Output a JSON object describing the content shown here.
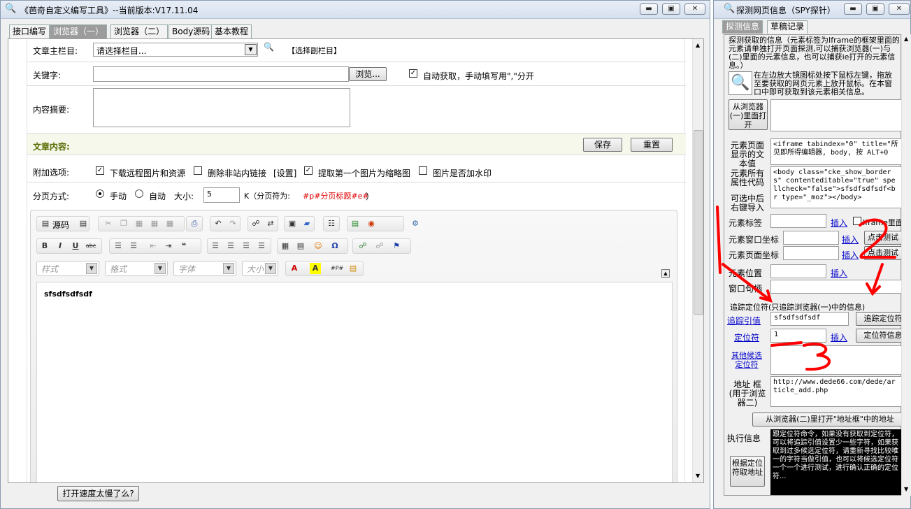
{
  "main_window": {
    "title": "《芭奇自定义编写工具》--当前版本:V17.11.04",
    "tabs": [
      "接口编写",
      "浏览器（一）",
      "浏览器（二）",
      "Body源码",
      "基本教程"
    ],
    "form": {
      "column_label": "文章主栏目:",
      "column_value": "请选择栏目...",
      "sub_column_link": "【选择副栏目】",
      "keywords_label": "关键字:",
      "keywords_value": "",
      "browse_button": "浏览...",
      "auto_fetch_label": "自动获取，手动填写用\",\"分开",
      "summary_label": "内容摘要:",
      "content_label": "文章内容:",
      "save_button": "保存",
      "reset_button": "重置",
      "extra_label": "附加选项:",
      "opt_download": "下载远程图片和资源",
      "opt_remove_links": "删除非站内链接",
      "opt_settings": "[设置]",
      "opt_first_image": "提取第一个图片为缩略图",
      "opt_watermark": "图片是否加水印",
      "paging_label": "分页方式:",
      "paging_manual": "手动",
      "paging_auto": "自动",
      "size_label": "大小:",
      "size_value": "5",
      "size_unit": "K（分页符为:",
      "paging_token": "#p#分页标题#e#",
      "paging_close": "）"
    },
    "editor": {
      "source_label": "源码",
      "style_combo": "样式",
      "format_combo": "格式",
      "font_combo": "字体",
      "size_combo": "大小",
      "content": "sfsdfsdfsdf"
    },
    "speed_button": "打开速度太慢了么?"
  },
  "spy_window": {
    "title": "探测网页信息（SPY探针）",
    "tabs": [
      "探测信息",
      "草稿记录"
    ],
    "intro_text": "探测获取的信息（元素标签为Iframe的框架里面的元素请单独打开页面探测,可以捕获浏览器(一)与(二)里面的元素信息，也可以捕获ie打开的元素信息。）",
    "magnifier_text": "在左边放大镜图标处按下鼠标左键，拖放至要获取的网页元素上放开鼠标。在本窗口中即可获取到该元素相关信息。",
    "open_from_browser1": "从浏览器(一)里面打开",
    "element_text_label": "元素页面显示的文本值",
    "element_text_value": "<iframe tabindex=\"0\" title=\"所见即所得编辑器, body, 按 ALT+0",
    "element_attrs_label": "元素所有属性代码",
    "element_attrs_value": "<body class=\"cke_show_borders\" contenteditable=\"true\" spellcheck=\"false\">sfsdfsdfsdf<br type=\"_moz\"></body>",
    "right_click_label": "可选中后右键导入",
    "tag_label": "元素标签",
    "tag_value": "",
    "insert_link": "插入",
    "iframe_inside_label": "Iframe里面",
    "win_coord_label": "元素窗口坐标",
    "page_coord_label": "元素页面坐标",
    "click_test_button": "点击测试",
    "position_label": "元素位置",
    "window_handle_label": "窗口句柄",
    "track_section_label": "追踪定位符(只追踪浏览器(一)中的信息)",
    "track_ref_link": "追踪引值",
    "track_ref_value": "sfsdfsdfsdf",
    "track_locator_button": "追踪定位符",
    "locator_link": "定位符",
    "locator_value": "1",
    "locator_info_button": "定位符信息",
    "other_locator_link": "其他候选定位符",
    "address_label": "地址 框(用于浏览器二)",
    "address_value": "http://www.dede66.com/dede/article_add.php",
    "open_in_browser2_button": "从浏览器(二)里打开\"地址框\"中的地址",
    "exec_info_label": "执行信息",
    "exec_info_text": "跟定位符命令，如果没有获取到定位符，可以将追踪引值设置少一些字符，如果获取到过多候选定位符，请重新寻找比较唯一的字符当做引值，也可以将候选定位符一个一个进行测试，进行确认正确的定位符...",
    "get_address_button": "根据定位符取地址"
  },
  "annotations": {
    "mark_1": "1",
    "mark_2": "2",
    "mark_3": "3",
    "color": "#ff0000"
  }
}
